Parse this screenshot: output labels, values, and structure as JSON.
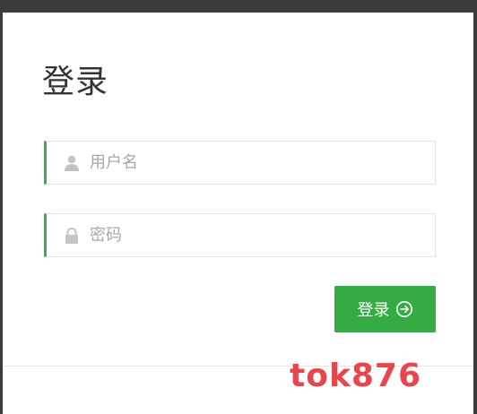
{
  "page": {
    "title": "登录",
    "watermark": "tok876"
  },
  "form": {
    "username_placeholder": "用户名",
    "password_placeholder": "密码",
    "submit_label": "登录"
  },
  "icons": {
    "username": "user-icon",
    "password": "lock-icon",
    "submit": "circle-arrow-right-icon"
  },
  "colors": {
    "accent": "#35ab44",
    "field_accent": "#3fae49",
    "watermark": "#e8464c",
    "placeholder": "#a8a8a8"
  }
}
